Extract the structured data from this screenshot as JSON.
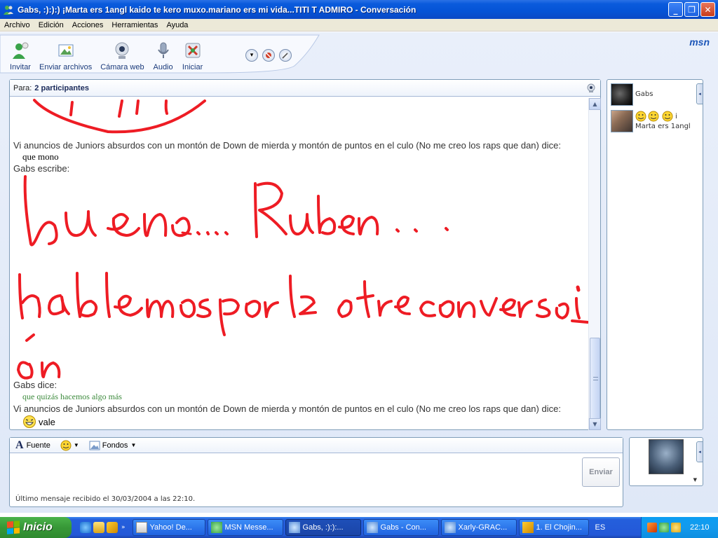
{
  "window": {
    "title": "Gabs, :):):) ¡Marta ers 1angl kaido te kero muxo.mariano ers mi vida...TITI T ADMIRO - Conversación",
    "minimize": "_",
    "maximize": "❐",
    "close": "✕"
  },
  "menu": [
    "Archivo",
    "Edición",
    "Acciones",
    "Herramientas",
    "Ayuda"
  ],
  "toolbar": {
    "buttons": [
      "Invitar",
      "Enviar archivos",
      "Cámara web",
      "Audio",
      "Iniciar"
    ],
    "logo": "msn"
  },
  "conversation": {
    "to_label": "Para:",
    "participants": "2 participantes",
    "lines": [
      {
        "kind": "header",
        "text": "Vi anuncios de Juniors absurdos con un montón de Down de mierda y montón de puntos en el culo (No me creo los raps que dan) dice:"
      },
      {
        "kind": "msg",
        "text": "que mono"
      },
      {
        "kind": "header",
        "text": "Gabs escribe:"
      },
      {
        "kind": "header",
        "text": "Gabs dice:"
      },
      {
        "kind": "msg",
        "text": "que quizás hacemos algo más"
      },
      {
        "kind": "header",
        "text": "Vi anuncios de Juniors absurdos con un montón de Down de mierda y montón de puntos en el culo (No me creo los raps que dan) dice:"
      },
      {
        "kind": "msg",
        "text": "vale"
      }
    ],
    "handwriting": "bueno..... Ruben ... hablemos por la otra conversaci ón"
  },
  "contacts": [
    {
      "name": "Gabs"
    },
    {
      "name_line1": "i",
      "name_line2": "Marta ers 1angl"
    }
  ],
  "compose": {
    "font_label": "Fuente",
    "backgrounds_label": "Fondos",
    "send_label": "Enviar",
    "status": "Último mensaje recibido el 30/03/2004 a las 22:10."
  },
  "taskbar": {
    "start_label": "Inicio",
    "more": "»",
    "tasks": [
      "Yahoo! De...",
      "MSN Messe...",
      "Gabs, :):):...",
      "Gabs - Con...",
      "Xarly-GRAC...",
      "1. El Chojin..."
    ],
    "language": "ES",
    "clock": "22:10"
  },
  "colors": {
    "accent": "#0553d6",
    "handwriting": "#ee1c24",
    "start": "#379837"
  }
}
